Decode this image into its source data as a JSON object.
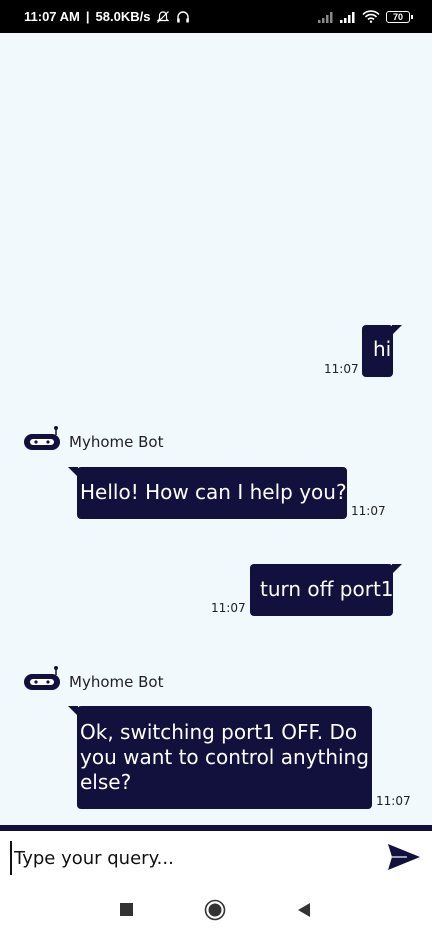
{
  "status_bar": {
    "time": "11:07 AM",
    "speed": "58.0KB/s",
    "battery": "70",
    "icons": [
      "mute-icon",
      "headphones-icon",
      "signal-icon",
      "signal-icon",
      "wifi-icon",
      "battery-icon"
    ]
  },
  "messages": [
    {
      "sender": "user",
      "text": "hi",
      "time": "11:07"
    },
    {
      "sender": "bot",
      "name": "Myhome Bot",
      "text": "Hello! How can I help you?",
      "time": "11:07"
    },
    {
      "sender": "user",
      "text": "turn off port1",
      "time": "11:07"
    },
    {
      "sender": "bot",
      "name": "Myhome Bot",
      "lines": [
        "Ok, switching port1 OFF. Do",
        "you want to control anything",
        "else?"
      ],
      "time": "11:07"
    }
  ],
  "input": {
    "placeholder": "Type your query..."
  },
  "nav": {
    "icons": [
      "recents-icon",
      "home-icon",
      "back-icon"
    ]
  },
  "colors": {
    "accent": "#12113e",
    "background": "#f1f9fd"
  }
}
